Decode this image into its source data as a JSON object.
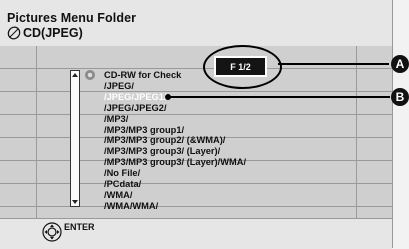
{
  "header": {
    "title": "Pictures Menu  Folder",
    "subtitle": "CD(JPEG)"
  },
  "page_indicator": "F  1/2",
  "folders": [
    {
      "label": "CD-RW for Check",
      "selected": false
    },
    {
      "label": "/JPEG/",
      "selected": false
    },
    {
      "label": "/JPEG/JPEG1/",
      "selected": true
    },
    {
      "label": "/JPEG/JPEG2/",
      "selected": false
    },
    {
      "label": "/MP3/",
      "selected": false
    },
    {
      "label": "/MP3/MP3 group1/",
      "selected": false
    },
    {
      "label": "/MP3/MP3 group2/ (&WMA)/",
      "selected": false
    },
    {
      "label": "/MP3/MP3 group3/ (Layer)/",
      "selected": false
    },
    {
      "label": "/MP3/MP3 group3/ (Layer)/WMA/",
      "selected": false
    },
    {
      "label": "/No File/",
      "selected": false
    },
    {
      "label": "/PCdata/",
      "selected": false
    },
    {
      "label": "/WMA/",
      "selected": false
    },
    {
      "label": "/WMA/WMA/",
      "selected": false
    }
  ],
  "footer": {
    "enter_label": "ENTER",
    "enter_icon": "remote-enter-button-icon"
  },
  "callouts": {
    "a": "A",
    "b": "B"
  },
  "colors": {
    "selected_text": "#ffffff",
    "badge_background": "#141414"
  }
}
